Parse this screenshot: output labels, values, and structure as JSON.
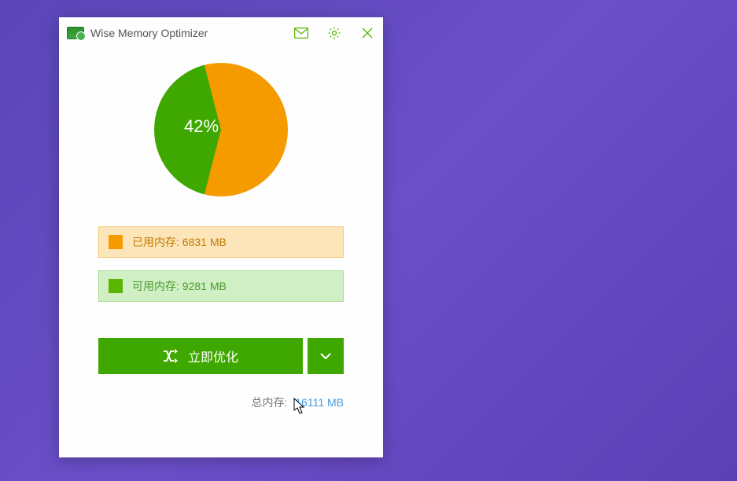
{
  "title": "Wise Memory Optimizer",
  "chart_data": {
    "type": "pie",
    "categories": [
      "已用内存",
      "可用内存"
    ],
    "values": [
      42,
      58
    ],
    "colors": [
      "#3fa800",
      "#f59b00"
    ],
    "center_label": "42%"
  },
  "stats": {
    "used_label": "已用内存: 6831 MB",
    "free_label": "可用内存: 9281 MB"
  },
  "actions": {
    "optimize_label": "立即优化"
  },
  "footer": {
    "total_label": "总内存:",
    "total_value": "16111 MB"
  },
  "colors": {
    "green": "#3fa800",
    "orange": "#f59b00",
    "free_bg": "#d1efc4",
    "used_bg": "#fce5b9"
  }
}
